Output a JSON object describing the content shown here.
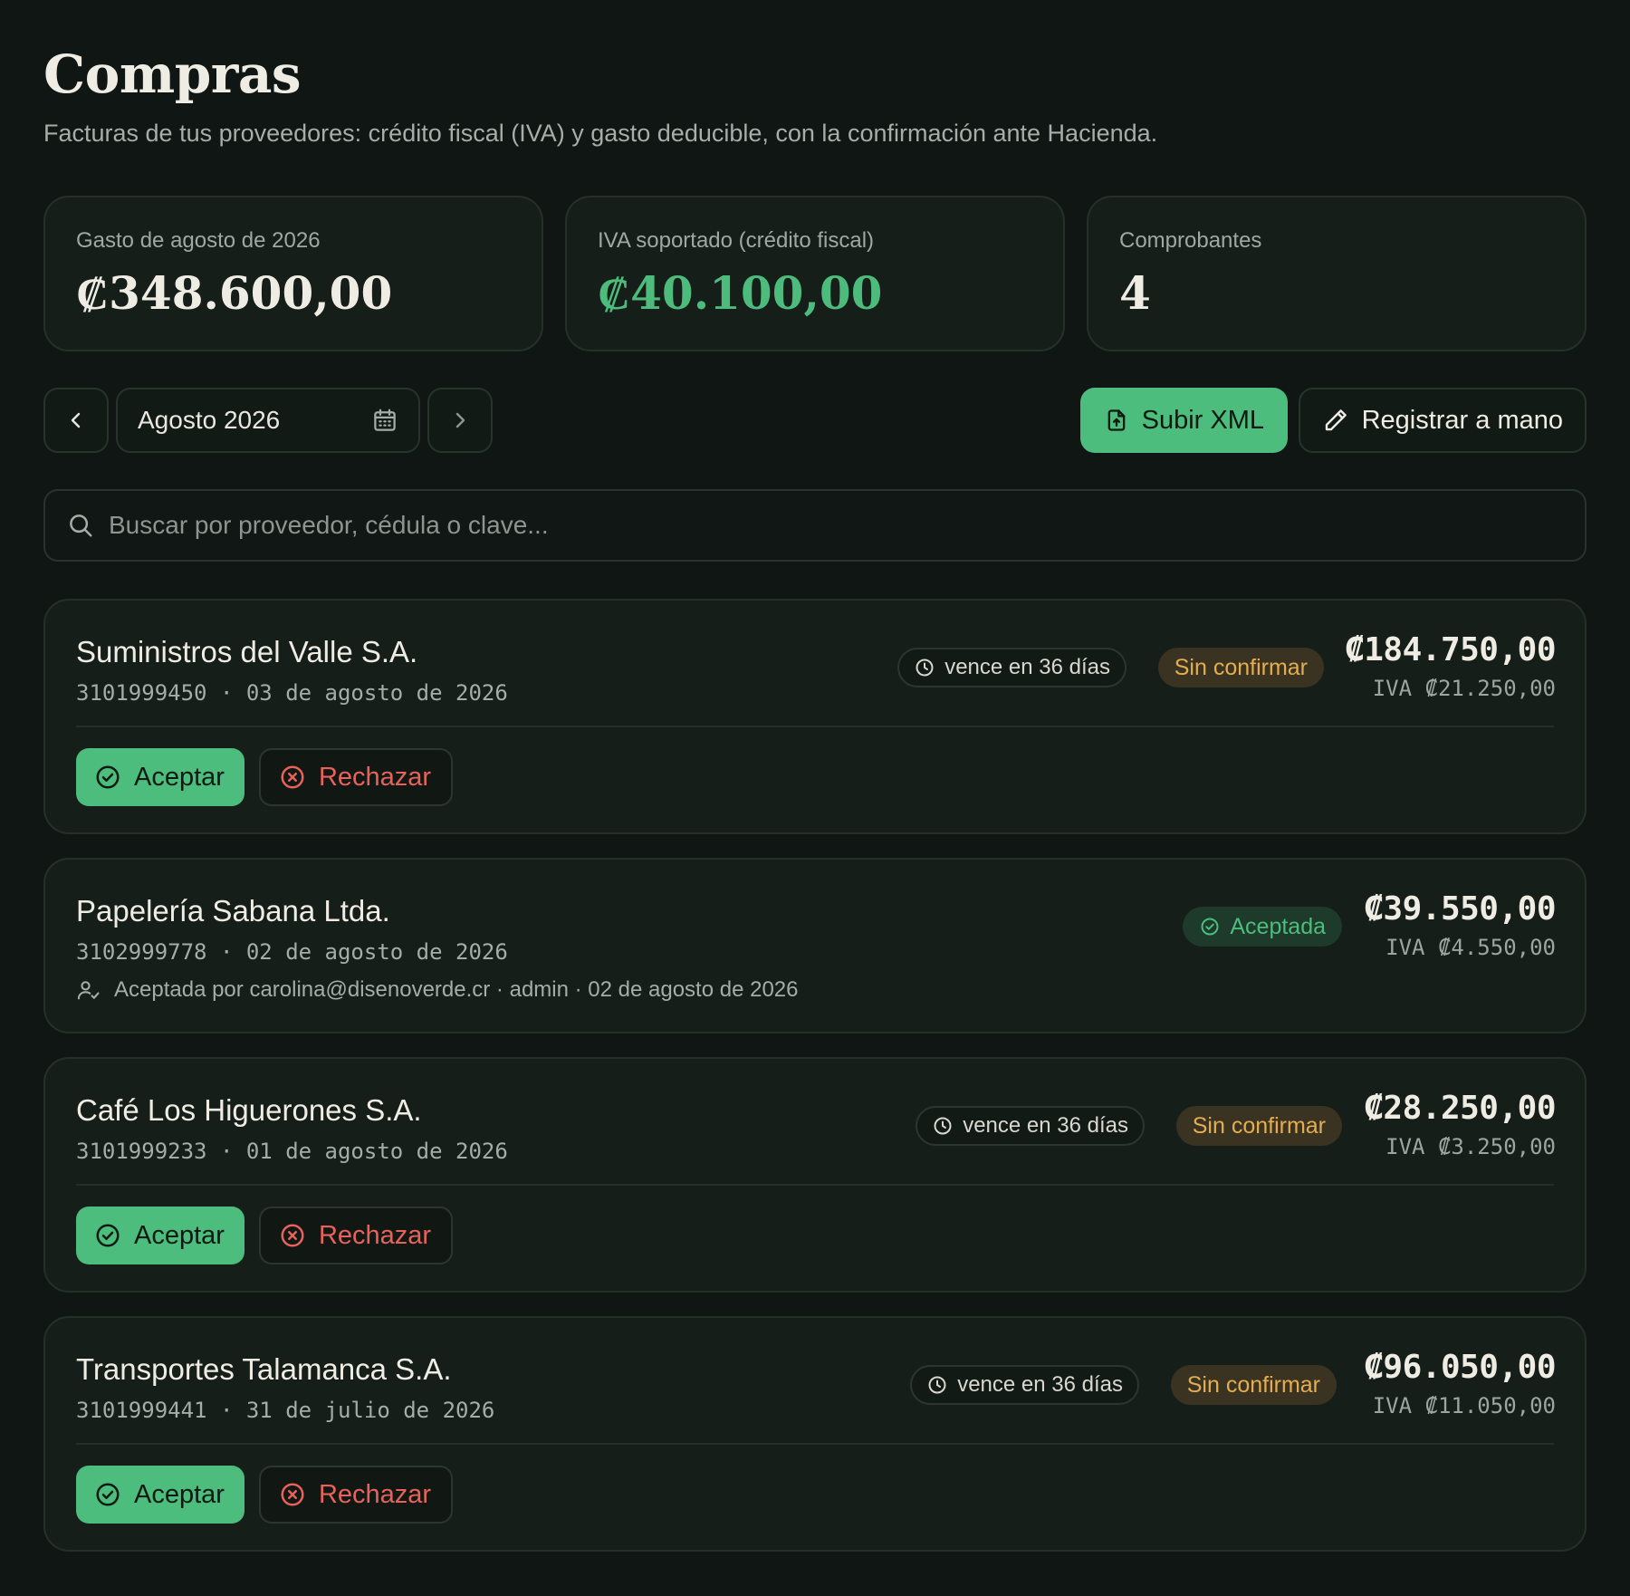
{
  "page": {
    "title": "Compras",
    "subtitle": "Facturas de tus proveedores: crédito fiscal (IVA) y gasto deducible, con la confirmación ante Hacienda."
  },
  "stats": [
    {
      "label": "Gasto de agosto de 2026",
      "value": "₡348.600,00"
    },
    {
      "label": "IVA soportado (crédito fiscal)",
      "value": "₡40.100,00"
    },
    {
      "label": "Comprobantes",
      "value": "4"
    }
  ],
  "toolbar": {
    "month": "Agosto 2026",
    "upload_label": "Subir XML",
    "manual_label": "Registrar a mano"
  },
  "search": {
    "placeholder": "Buscar por proveedor, cédula o clave..."
  },
  "invoices": [
    {
      "supplier": "Suministros del Valle S.A.",
      "meta": "3101999450 · 03 de agosto de 2026",
      "due": "vence en 36 días",
      "status": "Sin confirmar",
      "amount": "₡184.750,00",
      "iva": "IVA ₡21.250,00",
      "accept_label": "Aceptar",
      "reject_label": "Rechazar"
    },
    {
      "supplier": "Papelería Sabana Ltda.",
      "meta": "3102999778 · 02 de agosto de 2026",
      "status": "Aceptada",
      "amount": "₡39.550,00",
      "iva": "IVA ₡4.550,00",
      "accepted_by": "Aceptada por carolina@disenoverde.cr · admin · 02 de agosto de 2026"
    },
    {
      "supplier": "Café Los Higuerones S.A.",
      "meta": "3101999233 · 01 de agosto de 2026",
      "due": "vence en 36 días",
      "status": "Sin confirmar",
      "amount": "₡28.250,00",
      "iva": "IVA ₡3.250,00",
      "accept_label": "Aceptar",
      "reject_label": "Rechazar"
    },
    {
      "supplier": "Transportes Talamanca S.A.",
      "meta": "3101999441 · 31 de julio de 2026",
      "due": "vence en 36 días",
      "status": "Sin confirmar",
      "amount": "₡96.050,00",
      "iva": "IVA ₡11.050,00",
      "accept_label": "Aceptar",
      "reject_label": "Rechazar"
    }
  ],
  "colors": {
    "background": "#0f1613",
    "card": "#161e1a",
    "accent_green": "#4cbd7d",
    "pending": "#e3ae4f",
    "reject": "#e8625b"
  },
  "icons": [
    "chevron-left-icon",
    "calendar-icon",
    "chevron-right-icon",
    "file-upload-icon",
    "pencil-icon",
    "search-icon",
    "clock-icon",
    "check-circle-icon",
    "x-circle-icon",
    "user-check-icon"
  ]
}
